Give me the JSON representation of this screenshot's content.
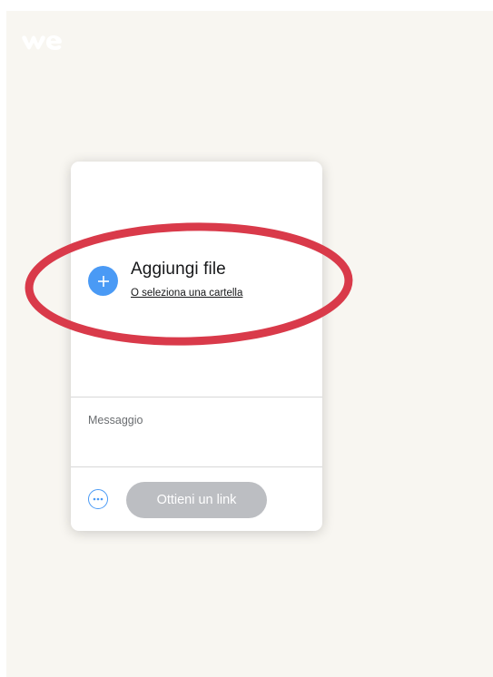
{
  "header": {
    "logo_icon": "wetransfer-we-logo"
  },
  "upload": {
    "add_button_icon": "plus-icon",
    "add_files_label": "Aggiungi file",
    "select_folder_label": "O seleziona una cartella"
  },
  "message": {
    "placeholder": "Messaggio",
    "value": ""
  },
  "actions": {
    "more_options_icon": "ellipsis-circle-icon",
    "get_link_label": "Ottieni un link"
  },
  "colors": {
    "background": "#f8f6f1",
    "accent_blue": "#4a9af5",
    "disabled_button": "#bcbec2",
    "annotation_red": "#d93a4a"
  }
}
